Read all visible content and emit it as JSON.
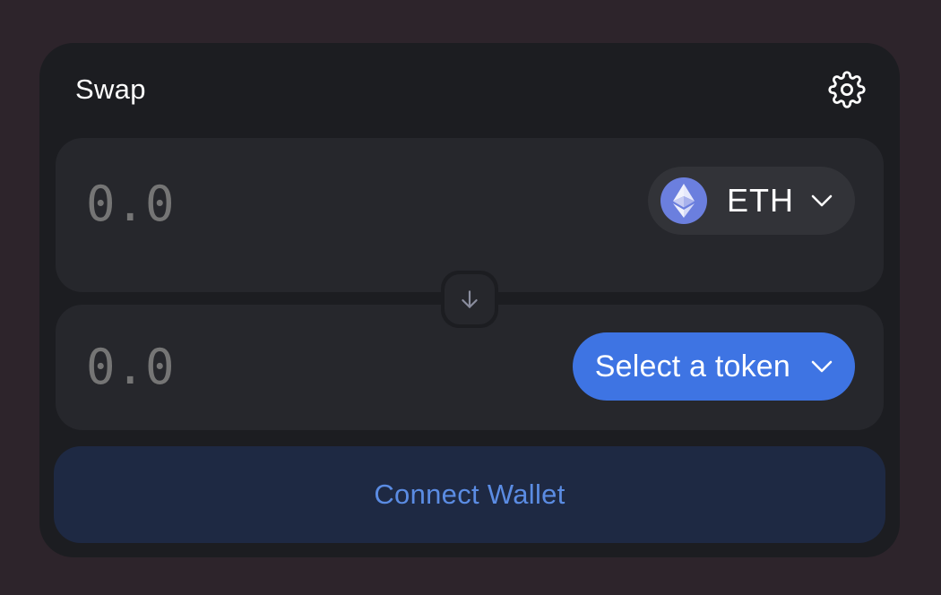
{
  "header": {
    "title": "Swap",
    "settings_icon": "gear-icon"
  },
  "input_panel": {
    "amount_placeholder": "0.0",
    "token": {
      "symbol": "ETH",
      "logo_icon": "ethereum-icon",
      "dropdown_icon": "chevron-down-icon"
    }
  },
  "switch_button": {
    "icon": "arrow-down-icon"
  },
  "output_panel": {
    "amount_placeholder": "0.0",
    "select_label": "Select a token",
    "dropdown_icon": "chevron-down-icon"
  },
  "connect_button": {
    "label": "Connect Wallet"
  },
  "colors": {
    "page_background": "#2d242b",
    "card_background": "#1c1d21",
    "panel_background": "#26272c",
    "token_pill_background": "#323338",
    "accent_blue": "#3e74e3",
    "connect_background": "#1e2943",
    "connect_text": "#5b8ce3",
    "amount_text": "#aeb2d1",
    "eth_logo": "#6b7fde"
  }
}
